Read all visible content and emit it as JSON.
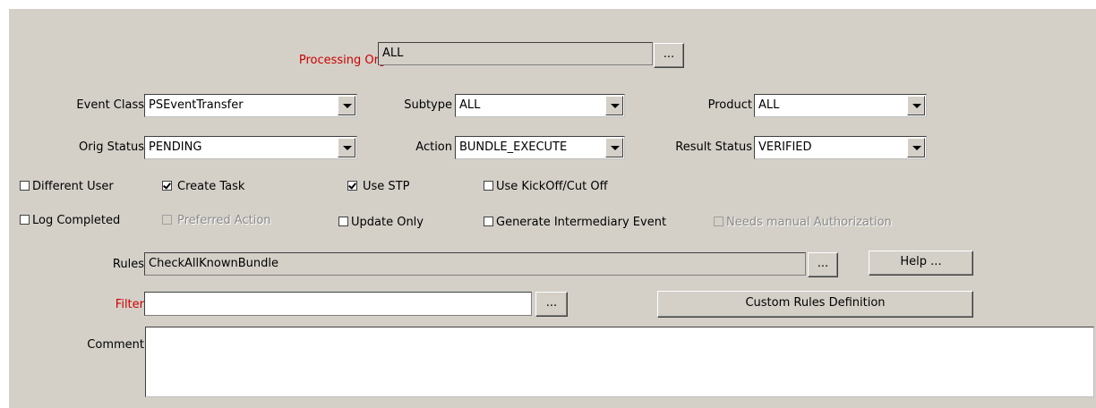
{
  "processing_org": {
    "label": "Processing Org",
    "value": "ALL",
    "lookup_label": "..."
  },
  "event_class": {
    "label": "Event Class",
    "value": "PSEventTransfer"
  },
  "subtype": {
    "label": "Subtype",
    "value": "ALL"
  },
  "product": {
    "label": "Product",
    "value": "ALL"
  },
  "orig_status": {
    "label": "Orig Status",
    "value": "PENDING"
  },
  "action": {
    "label": "Action",
    "value": "BUNDLE_EXECUTE"
  },
  "result_status": {
    "label": "Result Status",
    "value": "VERIFIED"
  },
  "checkboxes": {
    "different_user": {
      "label": "Different User",
      "checked": false
    },
    "create_task": {
      "label": "Create Task",
      "checked": true
    },
    "use_stp": {
      "label": "Use STP",
      "checked": true
    },
    "use_kickoff": {
      "label": "Use KickOff/Cut Off",
      "checked": false
    },
    "log_completed": {
      "label": "Log Completed",
      "checked": false
    },
    "preferred_action": {
      "label": "Preferred Action",
      "checked": false,
      "disabled": true
    },
    "update_only": {
      "label": "Update Only",
      "checked": false
    },
    "generate_intermediary": {
      "label": "Generate Intermediary Event",
      "checked": false
    },
    "needs_manual_auth": {
      "label": "Needs manual Authorization",
      "checked": false,
      "disabled": true
    }
  },
  "rules": {
    "label": "Rules",
    "value": "CheckAllKnownBundle",
    "lookup_label": "...",
    "help_label": "Help ..."
  },
  "filter": {
    "label": "Filter",
    "value": "",
    "lookup_label": "...",
    "custom_rules_label": "Custom Rules Definition"
  },
  "comment": {
    "label": "Comment",
    "value": ""
  },
  "colors": {
    "panel": "#d4d0c8",
    "required_label": "#cc0000"
  }
}
